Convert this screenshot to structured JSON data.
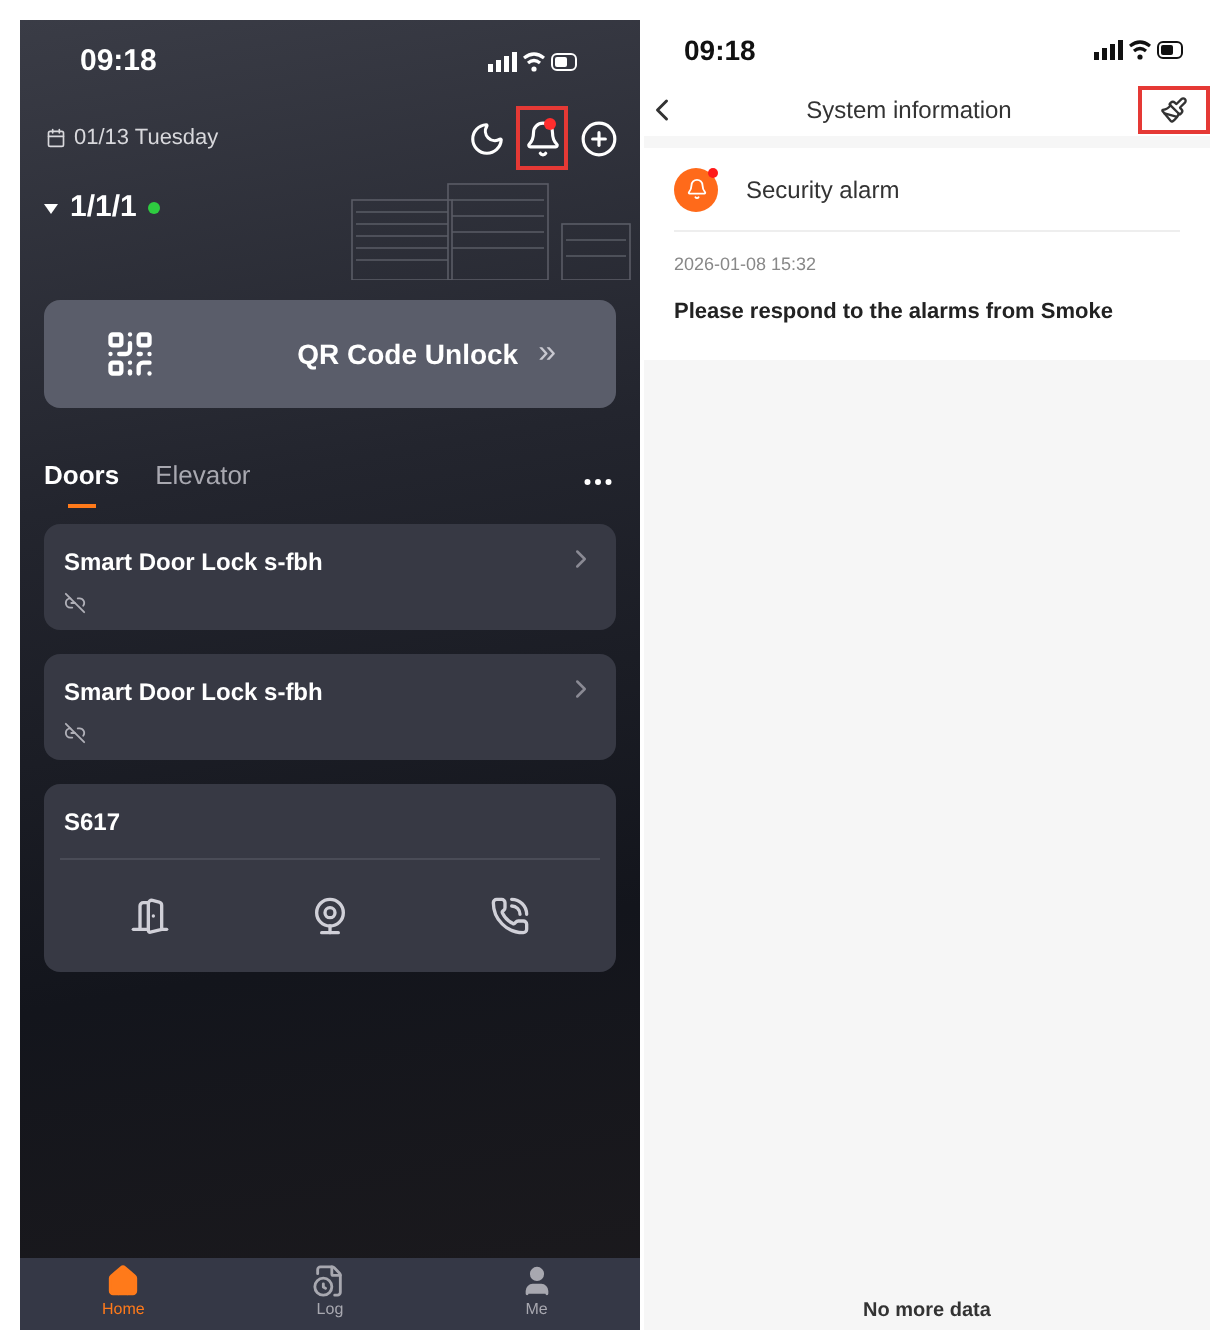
{
  "home": {
    "status_bar": {
      "time": "09:18"
    },
    "date": "01/13 Tuesday",
    "header_actions": [
      {
        "kind": "moon",
        "highlighted": false
      },
      {
        "kind": "bell",
        "highlighted": true,
        "badge": true
      },
      {
        "kind": "plus",
        "highlighted": false
      }
    ],
    "site": {
      "label": "1/1/1",
      "online": true
    },
    "qr_unlock": {
      "label": "QR Code Unlock",
      "chevron": "»"
    },
    "tabs": [
      {
        "label": "Doors",
        "selected": true
      },
      {
        "label": "Elevator",
        "selected": false
      }
    ],
    "devices": [
      {
        "kind": "lock",
        "name": "Smart Door Lock s-fbh"
      },
      {
        "kind": "lock",
        "name": "Smart Door Lock s-fbh"
      },
      {
        "kind": "intercom",
        "name": "S617"
      }
    ],
    "nav": [
      {
        "kind": "home",
        "label": "Home",
        "selected": true
      },
      {
        "kind": "log",
        "label": "Log",
        "selected": false
      },
      {
        "kind": "me",
        "label": "Me",
        "selected": false
      }
    ]
  },
  "system_info": {
    "status_bar": {
      "time": "09:18"
    },
    "title": "System information",
    "clear_highlighted": true,
    "messages": [
      {
        "category": "Security alarm",
        "unread": true,
        "time": "2026-01-08 15:32",
        "text": "Please respond to the alarms from Smoke"
      }
    ],
    "footer": "No more data"
  }
}
